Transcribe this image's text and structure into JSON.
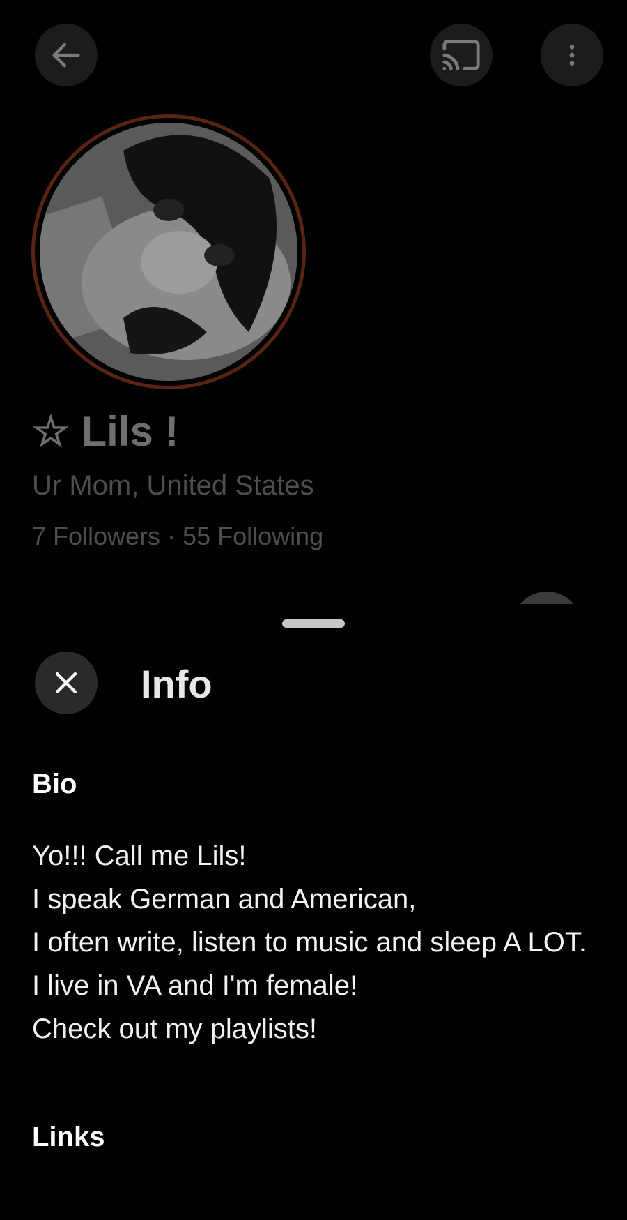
{
  "profile": {
    "name": "☆ Lils !",
    "location": "Ur Mom, United States",
    "followers_following": "7 Followers · 55 Following"
  },
  "icons": {
    "back": "arrow-left-icon",
    "cast": "cast-icon",
    "more": "more-vertical-icon",
    "close": "close-icon"
  },
  "colors": {
    "background": "#000000",
    "avatar_ring": "#5a2412"
  },
  "sheet": {
    "title": "Info",
    "bio_heading": "Bio",
    "bio_text": "Yo!!! Call me Lils!\nI speak German and American,\nI often write, listen to music and sleep A LOT.\nI live in VA and I'm female!\nCheck out my playlists!",
    "links_heading": "Links"
  }
}
